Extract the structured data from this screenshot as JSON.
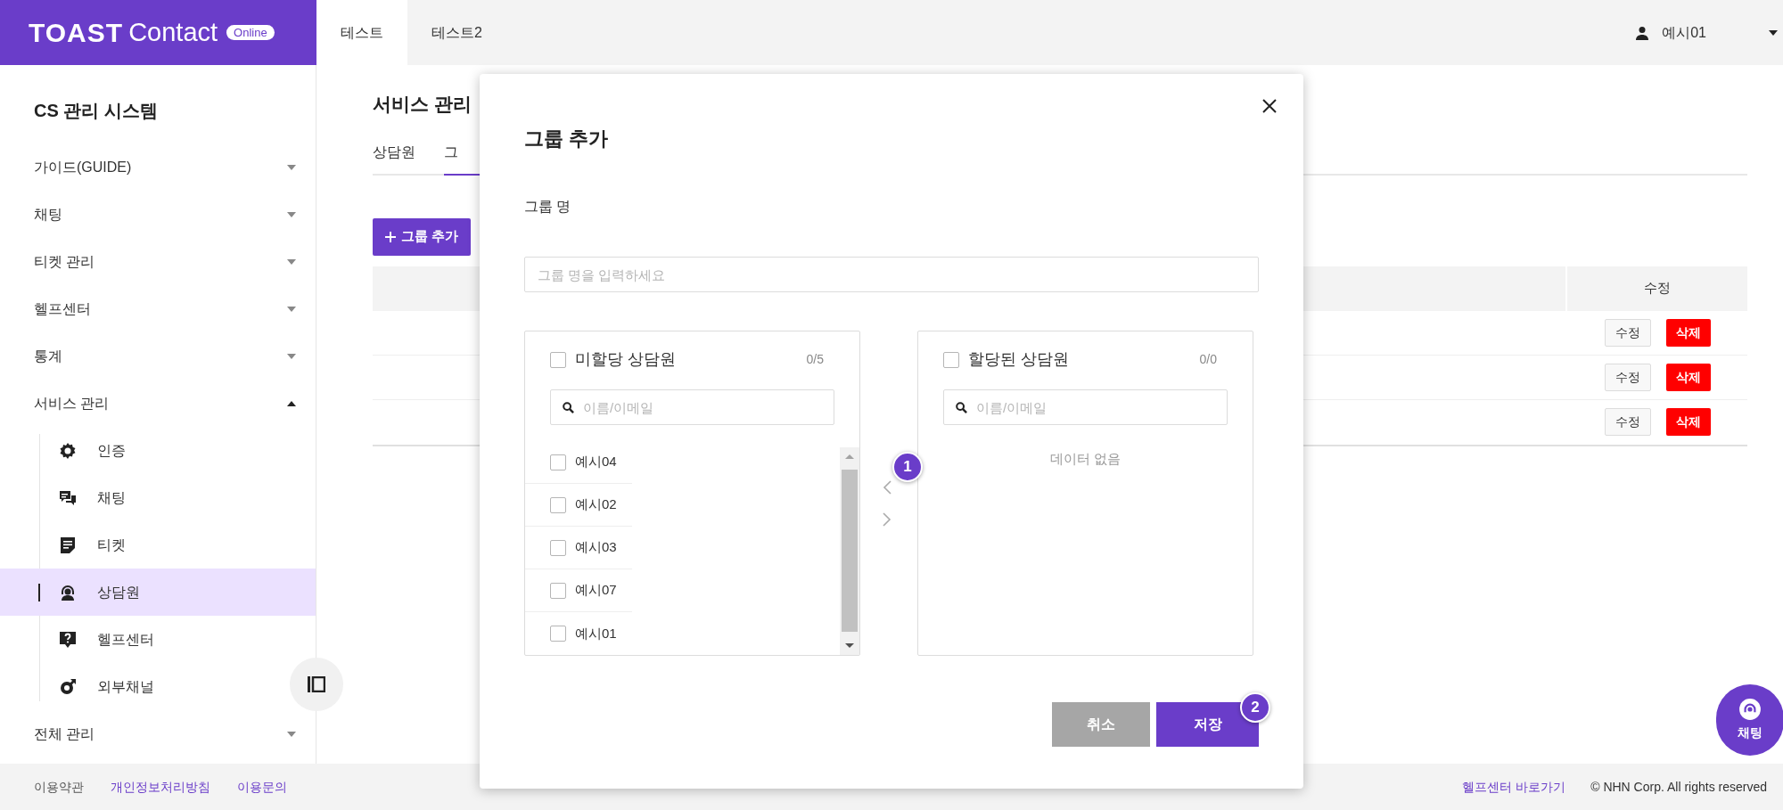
{
  "header": {
    "logo": {
      "wordmark": "TOAST",
      "product": "Contact",
      "badge": "Online"
    },
    "tabs": [
      {
        "label": "테스트",
        "selected": true
      },
      {
        "label": "테스트2",
        "selected": false
      }
    ],
    "user": {
      "name": "예시01"
    }
  },
  "sidebar": {
    "title": "CS 관리 시스템",
    "items": [
      {
        "label": "가이드(GUIDE)",
        "expanded": false
      },
      {
        "label": "채팅",
        "expanded": false
      },
      {
        "label": "티켓 관리",
        "expanded": false
      },
      {
        "label": "헬프센터",
        "expanded": false
      },
      {
        "label": "통계",
        "expanded": false
      },
      {
        "label": "서비스 관리",
        "expanded": true,
        "children": [
          {
            "label": "인증",
            "selected": false
          },
          {
            "label": "채팅",
            "selected": false
          },
          {
            "label": "티켓",
            "selected": false
          },
          {
            "label": "상담원",
            "selected": true
          },
          {
            "label": "헬프센터",
            "selected": false
          },
          {
            "label": "외부채널",
            "selected": false
          }
        ]
      },
      {
        "label": "전체 관리",
        "expanded": false
      }
    ]
  },
  "main": {
    "title": "서비스 관리",
    "tabs": [
      {
        "label": "상담원",
        "selected": false
      },
      {
        "label": "그",
        "selected": true
      }
    ],
    "add_button": "그룹 추가",
    "table": {
      "columns": [
        "수정"
      ],
      "rows": [
        {
          "edit": "수정",
          "delete": "삭제"
        },
        {
          "edit": "수정",
          "delete": "삭제"
        },
        {
          "edit": "수정",
          "delete": "삭제"
        }
      ]
    }
  },
  "modal": {
    "title": "그룹 추가",
    "name_label": "그룹 명",
    "name_field": {
      "placeholder": "그룹 명을 입력하세요"
    },
    "unassigned": {
      "title": "미할당 상담원",
      "count": "0/5",
      "checked": false,
      "search": {
        "placeholder": "이름/이메일"
      },
      "items": [
        {
          "name": "예시04",
          "checked": false
        },
        {
          "name": "예시02",
          "checked": false
        },
        {
          "name": "예시03",
          "checked": false
        },
        {
          "name": "예시07",
          "checked": false
        },
        {
          "name": "예시01",
          "checked": false
        }
      ]
    },
    "assigned": {
      "title": "할당된 상담원",
      "count": "0/0",
      "checked": false,
      "search": {
        "placeholder": "이름/이메일"
      },
      "empty": "데이터 없음"
    },
    "step_badges": [
      "1",
      "2"
    ],
    "buttons": {
      "cancel": "취소",
      "save": "저장"
    }
  },
  "chat_button": {
    "label": "채팅"
  },
  "footer": {
    "left_links": [
      {
        "label": "이용약관",
        "color": "#555555"
      },
      {
        "label": "개인정보처리방침",
        "color": "#6a3dc9"
      },
      {
        "label": "이용문의",
        "color": "#6a3dc9"
      }
    ],
    "help_link": "헬프센터 바로가기",
    "copyright": "© NHN Corp. All rights reserved"
  }
}
